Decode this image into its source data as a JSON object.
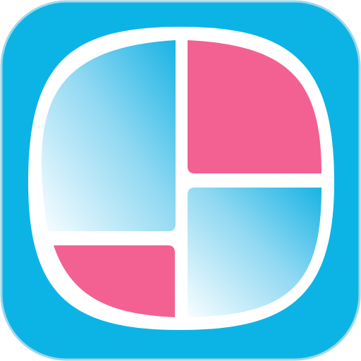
{
  "app_icon": {
    "icon_name": "collage-grid-app-icon",
    "colors": {
      "background": "#ffffff",
      "tile_blue": "#0cb4e6",
      "tile_border": "#9fd7ea",
      "frame": "#ffffff",
      "pink": "#f26192",
      "gradient_light": "#f8fdff",
      "gradient_dark": "#19b3e4"
    },
    "panels": [
      {
        "name": "top-left-panel",
        "fill": "blue-gradient"
      },
      {
        "name": "top-right-panel",
        "fill": "pink"
      },
      {
        "name": "bottom-left-panel",
        "fill": "pink"
      },
      {
        "name": "bottom-right-panel",
        "fill": "blue-gradient"
      }
    ]
  }
}
